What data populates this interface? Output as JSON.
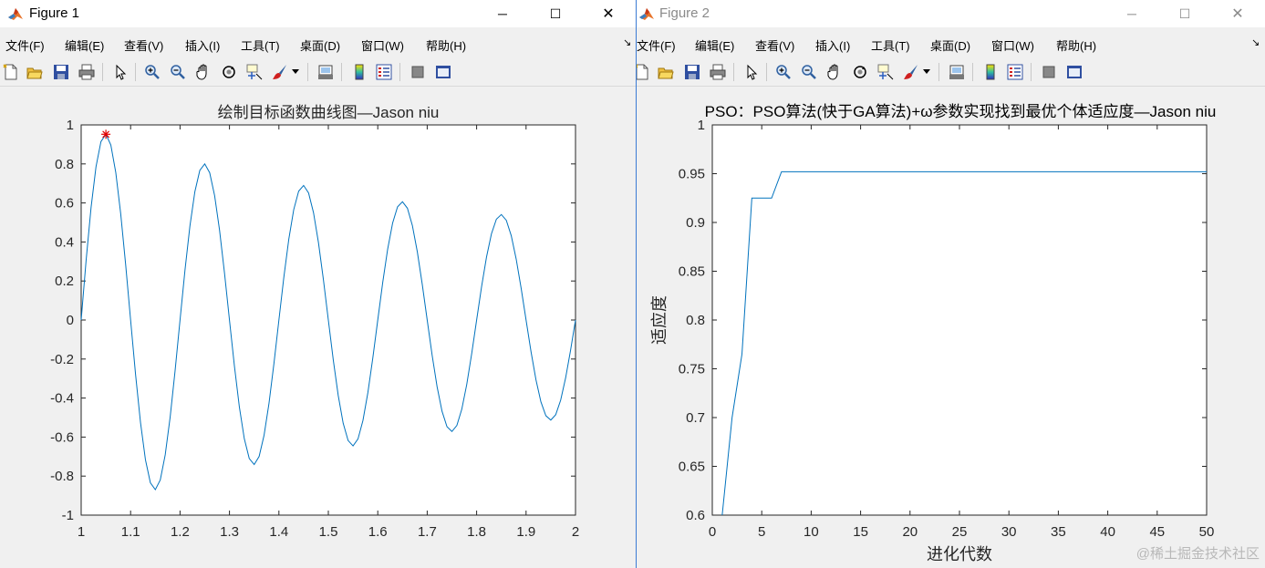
{
  "figure1": {
    "title": "Figure 1",
    "menu": [
      "文件(F)",
      "编辑(E)",
      "查看(V)",
      "插入(I)",
      "工具(T)",
      "桌面(D)",
      "窗口(W)",
      "帮助(H)"
    ],
    "controls": [
      "─",
      "☐",
      "✕"
    ]
  },
  "figure2": {
    "title": "Figure 2",
    "menu": [
      "文件(F)",
      "编辑(E)",
      "查看(V)",
      "插入(I)",
      "工具(T)",
      "桌面(D)",
      "窗口(W)",
      "帮助(H)"
    ],
    "controls": [
      "─",
      "☐",
      "✕"
    ]
  },
  "toolbar_icons": [
    "new-figure-icon",
    "open-file-icon",
    "save-icon",
    "print-icon",
    "edit-plot-arrow-icon",
    "zoom-in-icon",
    "zoom-out-icon",
    "pan-hand-icon",
    "rotate-3d-icon",
    "data-cursor-icon",
    "brush-icon",
    "link-plot-icon",
    "insert-colorbar-icon",
    "insert-legend-icon",
    "hide-plot-tools-icon",
    "show-plot-tools-icon"
  ],
  "watermark": "@稀土掘金技术社区",
  "colors": {
    "line": "#0072bd",
    "marker": "#e00000",
    "window_border": "#3b7bd4"
  },
  "chart_data": [
    {
      "type": "line",
      "title": "绘制目标函数曲线图—Jason niu",
      "xlabel": "",
      "ylabel": "",
      "xlim": [
        1,
        2
      ],
      "ylim": [
        -1,
        1
      ],
      "xticks": [
        1,
        1.1,
        1.2,
        1.3,
        1.4,
        1.5,
        1.6,
        1.7,
        1.8,
        1.9,
        2
      ],
      "yticks": [
        -1,
        -0.8,
        -0.6,
        -0.4,
        -0.2,
        0,
        0.2,
        0.4,
        0.6,
        0.8,
        1
      ],
      "function": "sin(10*pi*x)/x",
      "x_step": 0.01,
      "marker_point": {
        "x": 1.05,
        "y": 0.952,
        "symbol": "*"
      },
      "grid": false
    },
    {
      "type": "line",
      "title": "PSO：PSO算法(快于GA算法)+ω参数实现找到最优个体适应度—Jason niu",
      "xlabel": "进化代数",
      "ylabel": "适应度",
      "xlim": [
        0,
        50
      ],
      "ylim": [
        0.6,
        1
      ],
      "xticks": [
        0,
        5,
        10,
        15,
        20,
        25,
        30,
        35,
        40,
        45,
        50
      ],
      "yticks": [
        0.6,
        0.65,
        0.7,
        0.75,
        0.8,
        0.85,
        0.9,
        0.95,
        1
      ],
      "x": [
        1,
        2,
        3,
        4,
        5,
        6,
        7,
        8,
        9,
        10,
        11,
        12,
        13,
        14,
        15,
        16,
        17,
        18,
        19,
        20,
        21,
        22,
        23,
        24,
        25,
        26,
        27,
        28,
        29,
        30,
        31,
        32,
        33,
        34,
        35,
        36,
        37,
        38,
        39,
        40,
        41,
        42,
        43,
        44,
        45,
        46,
        47,
        48,
        49,
        50
      ],
      "y": [
        0.6,
        0.7,
        0.765,
        0.925,
        0.925,
        0.925,
        0.952,
        0.952,
        0.952,
        0.952,
        0.952,
        0.952,
        0.952,
        0.952,
        0.952,
        0.952,
        0.952,
        0.952,
        0.952,
        0.952,
        0.952,
        0.952,
        0.952,
        0.952,
        0.952,
        0.952,
        0.952,
        0.952,
        0.952,
        0.952,
        0.952,
        0.952,
        0.952,
        0.952,
        0.952,
        0.952,
        0.952,
        0.952,
        0.952,
        0.952,
        0.952,
        0.952,
        0.952,
        0.952,
        0.952,
        0.952,
        0.952,
        0.952,
        0.952,
        0.952
      ],
      "grid": false
    }
  ]
}
